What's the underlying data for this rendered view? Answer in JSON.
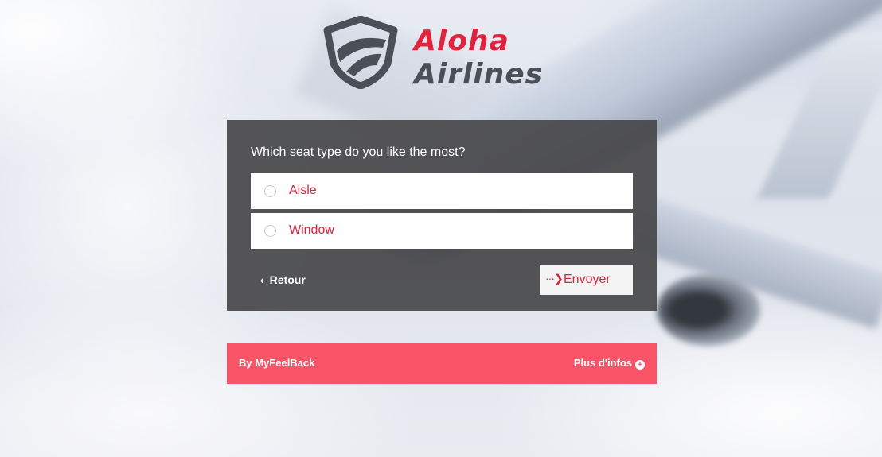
{
  "brand": {
    "name_line1": "Aloha",
    "name_line2": "Airlines",
    "logo_icon": "shield-icon"
  },
  "survey": {
    "question": "Which seat type do you like the most?",
    "options": [
      {
        "label": "Aisle",
        "selected": false
      },
      {
        "label": "Window",
        "selected": false
      }
    ],
    "back_label": "Retour",
    "send_label": "Envoyer"
  },
  "footer": {
    "by_label": "By MyFeelBack",
    "more_label": "Plus d'infos"
  },
  "colors": {
    "accent_red": "#d9243a",
    "footer_pink": "#fa5468",
    "card_dark": "#48484a",
    "logo_grey": "#4b4f57"
  }
}
